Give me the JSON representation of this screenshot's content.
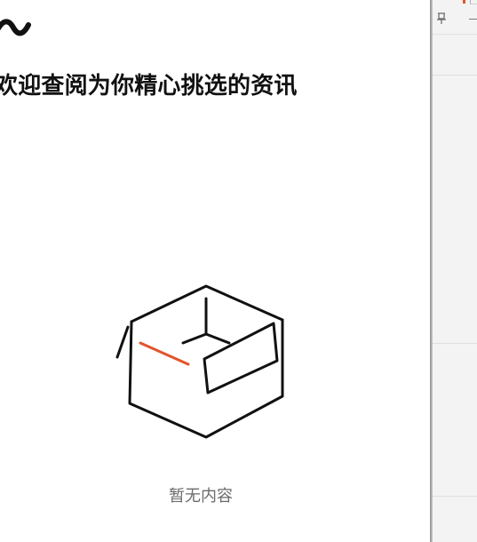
{
  "main": {
    "headline": "欢迎查阅为你精心挑选的资讯",
    "empty_state_text": "暂无内容",
    "logo_icon": "brand-wave-logo",
    "illustration_icon": "empty-box-icon"
  },
  "side_pane": {
    "pin_icon": "pin-icon",
    "minimize_icon": "minimize-icon"
  },
  "colors": {
    "background": "#ffffff",
    "headline": "#111111",
    "empty_text": "#6b6b6b",
    "box_stroke": "#111111",
    "accent": "#e2542b",
    "side_pane": "#f3f3f3"
  }
}
